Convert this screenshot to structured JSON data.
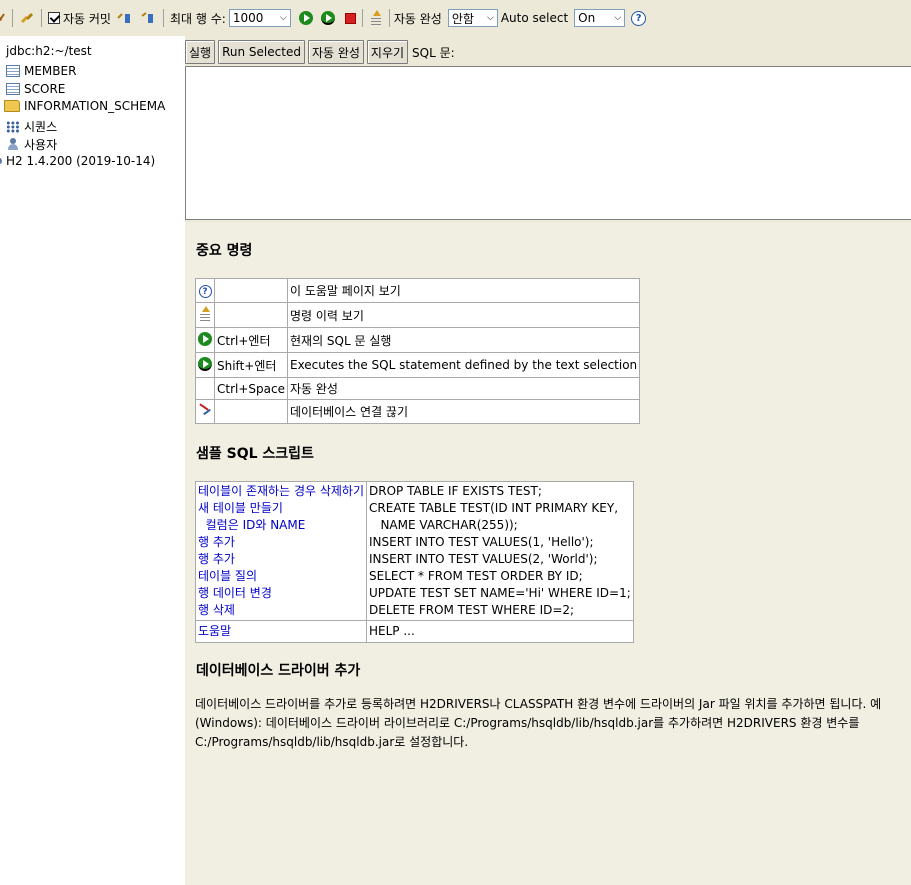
{
  "toolbar": {
    "auto_commit_label": "자동 커밋",
    "max_rows_label": "최대 행 수:",
    "max_rows_value": "1000",
    "auto_complete_label": "자동 완성",
    "auto_complete_value": "안함",
    "auto_select_label": "Auto select",
    "auto_select_value": "On"
  },
  "tree": {
    "connection": "jdbc:h2:~/test",
    "items": [
      {
        "label": "MEMBER",
        "icon": "table-icon"
      },
      {
        "label": "SCORE",
        "icon": "table-icon"
      },
      {
        "label": "INFORMATION_SCHEMA",
        "icon": "folder-icon"
      },
      {
        "label": "시퀀스",
        "icon": "sequence-icon"
      },
      {
        "label": "사용자",
        "icon": "users-icon"
      }
    ],
    "version": "H2 1.4.200 (2019-10-14)"
  },
  "buttons": {
    "run": "실행",
    "run_selected": "Run Selected",
    "auto_complete": "자동 완성",
    "clear": "지우기",
    "sql_label": "SQL 문:"
  },
  "help": {
    "important_title": "중요 명령",
    "commands": [
      {
        "icon": "help-icon",
        "key": "",
        "desc": "이 도움말 페이지 보기"
      },
      {
        "icon": "history-icon",
        "key": "",
        "desc": "명령 이력 보기"
      },
      {
        "icon": "run-icon",
        "key": "Ctrl+엔터",
        "desc": "현재의 SQL 문 실행"
      },
      {
        "icon": "run-selected-icon",
        "key": "Shift+엔터",
        "desc": "Executes the SQL statement defined by the text selection"
      },
      {
        "icon": "",
        "key": "Ctrl+Space",
        "desc": "자동 완성"
      },
      {
        "icon": "disconnect-icon",
        "key": "",
        "desc": "데이터베이스 연결 끊기"
      }
    ],
    "sample_title": "샘플 SQL 스크립트",
    "sample_rows": [
      {
        "label": "테이블이 존재하는 경우 삭제하기",
        "sql": "DROP TABLE IF EXISTS TEST;"
      },
      {
        "label": "새 테이블 만들기",
        "sql": "CREATE TABLE TEST(ID INT PRIMARY KEY,"
      },
      {
        "label": "  컬럼은 ID와 NAME",
        "sql": "   NAME VARCHAR(255));"
      },
      {
        "label": "행 추가",
        "sql": "INSERT INTO TEST VALUES(1, 'Hello');"
      },
      {
        "label": "행 추가",
        "sql": "INSERT INTO TEST VALUES(2, 'World');"
      },
      {
        "label": "테이블 질의",
        "sql": "SELECT * FROM TEST ORDER BY ID;"
      },
      {
        "label": "행 데이터 변경",
        "sql": "UPDATE TEST SET NAME='Hi' WHERE ID=1;"
      },
      {
        "label": "행 삭제",
        "sql": "DELETE FROM TEST WHERE ID=2;"
      }
    ],
    "help_row": {
      "label": "도움말",
      "sql": "HELP ..."
    },
    "driver_title": "데이터베이스 드라이버 추가",
    "driver_text_1": "데이터베이스 드라이버를 추가로 등록하려면 H2DRIVERS나 CLASSPATH 환경 변수에 드라이버의 Jar 파일 위치를 추가하면 됩니다. 예",
    "driver_text_2": "(Windows): 데이터베이스 드라이버 라이브러리로 C:/Programs/hsqldb/lib/hsqldb.jar를 추가하려면 H2DRIVERS 환경 변수를",
    "driver_text_3": "C:/Programs/hsqldb/lib/hsqldb.jar로 설정합니다."
  }
}
